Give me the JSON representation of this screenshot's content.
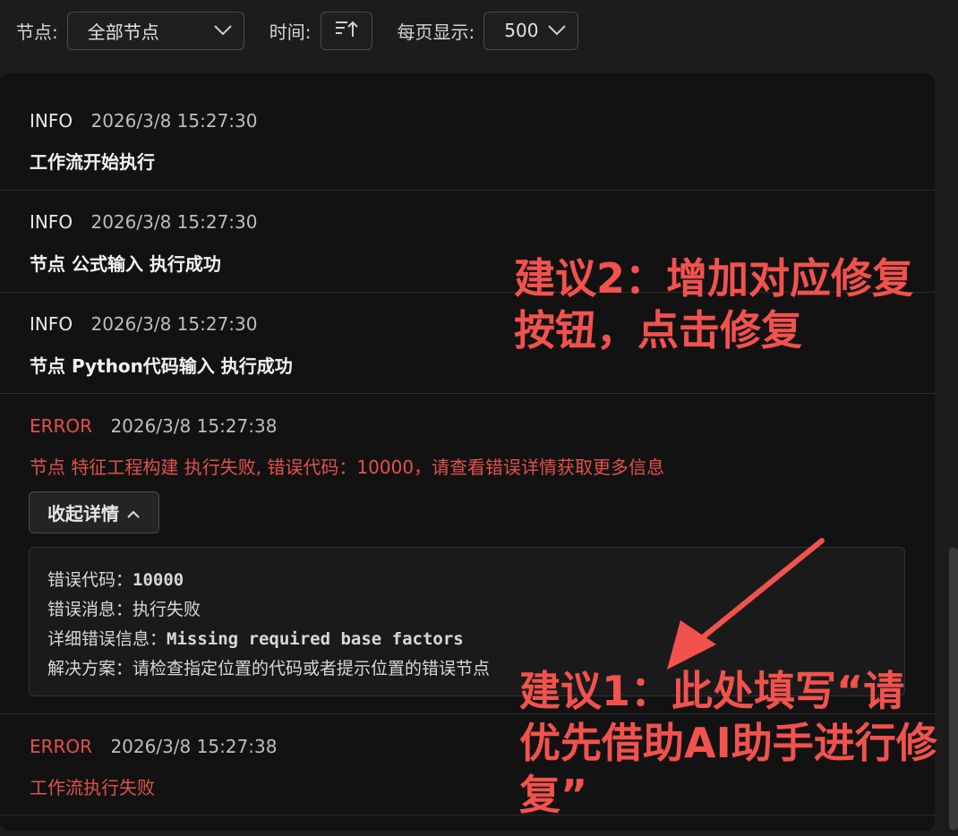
{
  "toolbar": {
    "node_label": "节点:",
    "node_value": "全部节点",
    "time_label": "时间:",
    "sort_icon": "sort-ascending-icon",
    "page_label": "每页显示:",
    "page_value": "500"
  },
  "logs": [
    {
      "level": "INFO",
      "time": "2026/3/8 15:27:30",
      "message": "工作流开始执行"
    },
    {
      "level": "INFO",
      "time": "2026/3/8 15:27:30",
      "message": "节点 公式输入 执行成功"
    },
    {
      "level": "INFO",
      "time": "2026/3/8 15:27:30",
      "message": "节点 Python代码输入 执行成功"
    },
    {
      "level": "ERROR",
      "time": "2026/3/8 15:27:38",
      "message": "节点 特征工程构建 执行失败, 错误代码：10000，请查看错误详情获取更多信息"
    },
    {
      "level": "ERROR",
      "time": "2026/3/8 15:27:38",
      "message": "工作流执行失败"
    }
  ],
  "details": {
    "toggle_label": "收起详情",
    "code_label": "错误代码：",
    "code_value": "10000",
    "message_label": "错误消息：",
    "message_value": "执行失败",
    "detail_label": "详细错误信息：",
    "detail_value": "Missing required base factors",
    "solution_label": "解决方案：",
    "solution_value": "请检查指定位置的代码或者提示位置的错误节点"
  },
  "annotations": {
    "suggestion_2_line1": "建议2：增加对应修复",
    "suggestion_2_line2": "按钮，点击修复",
    "suggestion_1_line1": "建议1：此处填写“请",
    "suggestion_1_line2": "优先借助AI助手进行修",
    "suggestion_1_line3": "复”"
  },
  "colors": {
    "error": "#e0524a",
    "annotation": "#f2524d"
  }
}
